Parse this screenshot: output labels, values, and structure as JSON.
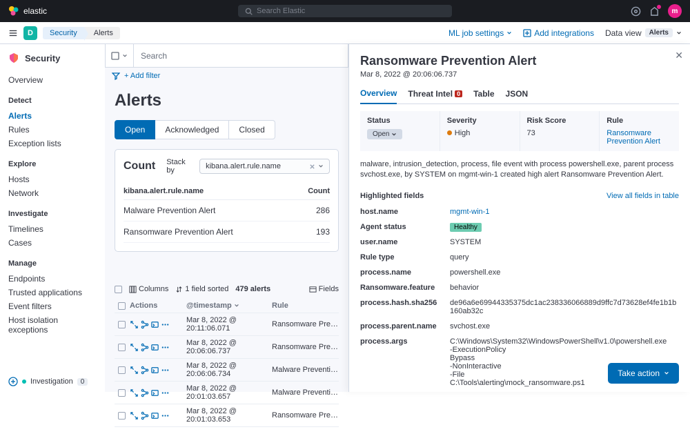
{
  "header": {
    "product": "elastic",
    "search_placeholder": "Search Elastic",
    "avatar_initial": "m"
  },
  "breadcrumb": {
    "space_initial": "D",
    "app": "Security",
    "page": "Alerts"
  },
  "sub_header": {
    "ml_settings": "ML job settings",
    "add_integrations": "Add integrations",
    "data_view": "Data view",
    "alerts_badge": "Alerts"
  },
  "sidebar": {
    "title": "Security",
    "groups": [
      {
        "items": [
          "Overview"
        ]
      },
      {
        "heading": "Detect",
        "items": [
          "Alerts",
          "Rules",
          "Exception lists"
        ]
      },
      {
        "heading": "Explore",
        "items": [
          "Hosts",
          "Network"
        ]
      },
      {
        "heading": "Investigate",
        "items": [
          "Timelines",
          "Cases"
        ]
      },
      {
        "heading": "Manage",
        "items": [
          "Endpoints",
          "Trusted applications",
          "Event filters",
          "Host isolation exceptions"
        ]
      }
    ],
    "active": "Alerts"
  },
  "query": {
    "search_placeholder": "Search",
    "add_filter": "+ Add filter"
  },
  "page": {
    "title": "Alerts",
    "status_tabs": [
      "Open",
      "Acknowledged",
      "Closed"
    ],
    "active_status": "Open"
  },
  "count_panel": {
    "title": "Count",
    "stack_by_label": "Stack by",
    "stack_by_value": "kibana.alert.rule.name",
    "col_name": "kibana.alert.rule.name",
    "col_count": "Count",
    "rows": [
      {
        "name": "Malware Prevention Alert",
        "count": 286
      },
      {
        "name": "Ransomware Prevention Alert",
        "count": 193
      }
    ]
  },
  "toolbar": {
    "columns": "Columns",
    "sorted": "1 field sorted",
    "alert_count": "479 alerts",
    "fields": "Fields"
  },
  "table": {
    "headers": {
      "actions": "Actions",
      "timestamp": "@timestamp",
      "rule": "Rule"
    },
    "rows": [
      {
        "ts": "Mar 8, 2022 @ 20:11:06.071",
        "rule": "Ransomware Prevention Al…"
      },
      {
        "ts": "Mar 8, 2022 @ 20:06:06.737",
        "rule": "Ransomware Prevention Al…"
      },
      {
        "ts": "Mar 8, 2022 @ 20:06:06.734",
        "rule": "Malware Prevention Alert"
      },
      {
        "ts": "Mar 8, 2022 @ 20:01:03.657",
        "rule": "Malware Prevention Alert"
      },
      {
        "ts": "Mar 8, 2022 @ 20:01:03.653",
        "rule": "Ransomware Prevention Al…"
      }
    ]
  },
  "flyout": {
    "title": "Ransomware Prevention Alert",
    "subtitle": "Mar 8, 2022 @ 20:06:06.737",
    "tabs": {
      "overview": "Overview",
      "threat_intel": "Threat Intel",
      "threat_count": "0",
      "table": "Table",
      "json": "JSON"
    },
    "cards": {
      "status_label": "Status",
      "status_value": "Open",
      "severity_label": "Severity",
      "severity_value": "High",
      "risk_label": "Risk Score",
      "risk_value": "73",
      "rule_label": "Rule",
      "rule_value": "Ransomware Prevention Alert"
    },
    "description": "malware, intrusion_detection, process, file event with process powershell.exe, parent process svchost.exe, by SYSTEM on mgmt-win-1 created high alert Ransomware Prevention Alert.",
    "highlighted_title": "Highlighted fields",
    "view_all": "View all fields in table",
    "fields": [
      {
        "k": "host.name",
        "v": "mgmt-win-1",
        "link": true
      },
      {
        "k": "Agent status",
        "v": "Healthy",
        "badge": true
      },
      {
        "k": "user.name",
        "v": "SYSTEM"
      },
      {
        "k": "Rule type",
        "v": "query"
      },
      {
        "k": "process.name",
        "v": "powershell.exe"
      },
      {
        "k": "Ransomware.feature",
        "v": "behavior"
      },
      {
        "k": "process.hash.sha256",
        "v": "de96a6e69944335375dc1ac238336066889d9ffc7d73628ef4fe1b1b160ab32c"
      },
      {
        "k": "process.parent.name",
        "v": "svchost.exe"
      },
      {
        "k": "process.args",
        "v": "C:\\Windows\\System32\\WindowsPowerShell\\v1.0\\powershell.exe\n-ExecutionPolicy\nBypass\n-NonInteractive\n-File\nC:\\Tools\\alerting\\mock_ransomware.ps1"
      }
    ],
    "take_action": "Take action"
  },
  "investigation": {
    "label": "Investigation",
    "count": "0"
  }
}
